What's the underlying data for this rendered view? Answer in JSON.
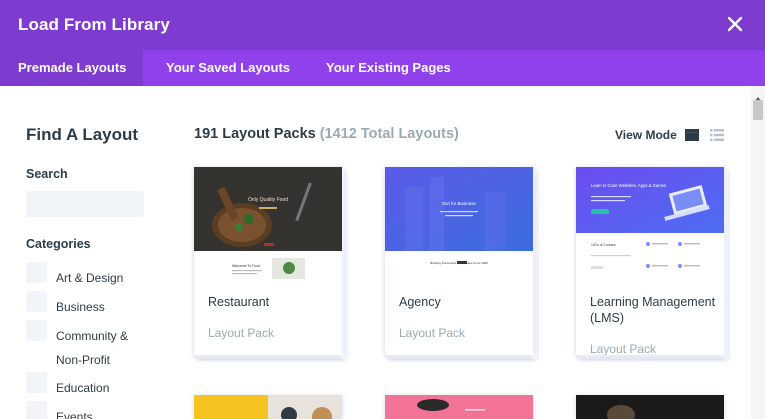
{
  "window": {
    "title": "Load From Library"
  },
  "tabs": [
    {
      "label": "Premade Layouts",
      "active": true
    },
    {
      "label": "Your Saved Layouts",
      "active": false
    },
    {
      "label": "Your Existing Pages",
      "active": false
    }
  ],
  "sidebar": {
    "title": "Find A Layout",
    "search_label": "Search",
    "search_value": "",
    "categories_label": "Categories",
    "categories": [
      {
        "line1": "Art & Design",
        "line2": ""
      },
      {
        "line1": "Business",
        "line2": ""
      },
      {
        "line1": "Community &",
        "line2": "Non-Profit"
      },
      {
        "line1": "Education",
        "line2": ""
      },
      {
        "line1": "Events",
        "line2": ""
      }
    ]
  },
  "main": {
    "packs_count": "191 Layout Packs",
    "total_layouts": "(1412 Total Layouts)",
    "view_mode_label": "View Mode",
    "cards": [
      {
        "name": "Restaurant",
        "type": "Layout Pack",
        "thumb_heading": "Only Quality Food",
        "thumb_caption": "Welcome To Food"
      },
      {
        "name": "Agency",
        "type": "Layout Pack",
        "thumb_heading": "Divi for Business",
        "thumb_caption": "Building Successful Businesses From 2008"
      },
      {
        "name": "Learning Management (LMS)",
        "type": "Layout Pack",
        "thumb_heading": "Learn to Code Websites, Apps & Games",
        "thumb_caption": "100's of Courses"
      }
    ]
  },
  "colors": {
    "header": "#7e3bd0",
    "tabbar": "#8f42ec",
    "text_dark": "#2c3d49",
    "text_muted": "#9aaab5"
  }
}
